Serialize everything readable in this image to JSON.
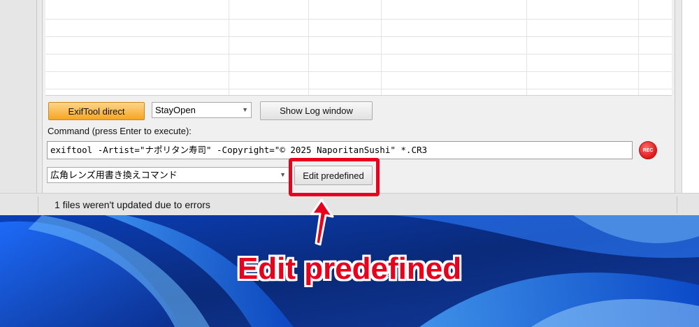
{
  "toolbar": {
    "exiftool_direct_label": "ExifTool direct",
    "stayopen_value": "StayOpen",
    "show_log_label": "Show Log window"
  },
  "command": {
    "label": "Command (press Enter to execute):",
    "value": "exiftool -Artist=\"ナポリタン寿司\" -Copyright=\"© 2025 NaporitanSushi\" *.CR3",
    "rec_label": "REC"
  },
  "predefined": {
    "selected": "広角レンズ用書き換えコマンド",
    "edit_label": "Edit predefined"
  },
  "status": {
    "message": "1 files weren't updated due to errors"
  },
  "annotation": {
    "caption": "Edit predefined",
    "color": "#e8001c"
  },
  "colors": {
    "exiftool_button": "#f5a623",
    "rec_button": "#d81b1b"
  }
}
